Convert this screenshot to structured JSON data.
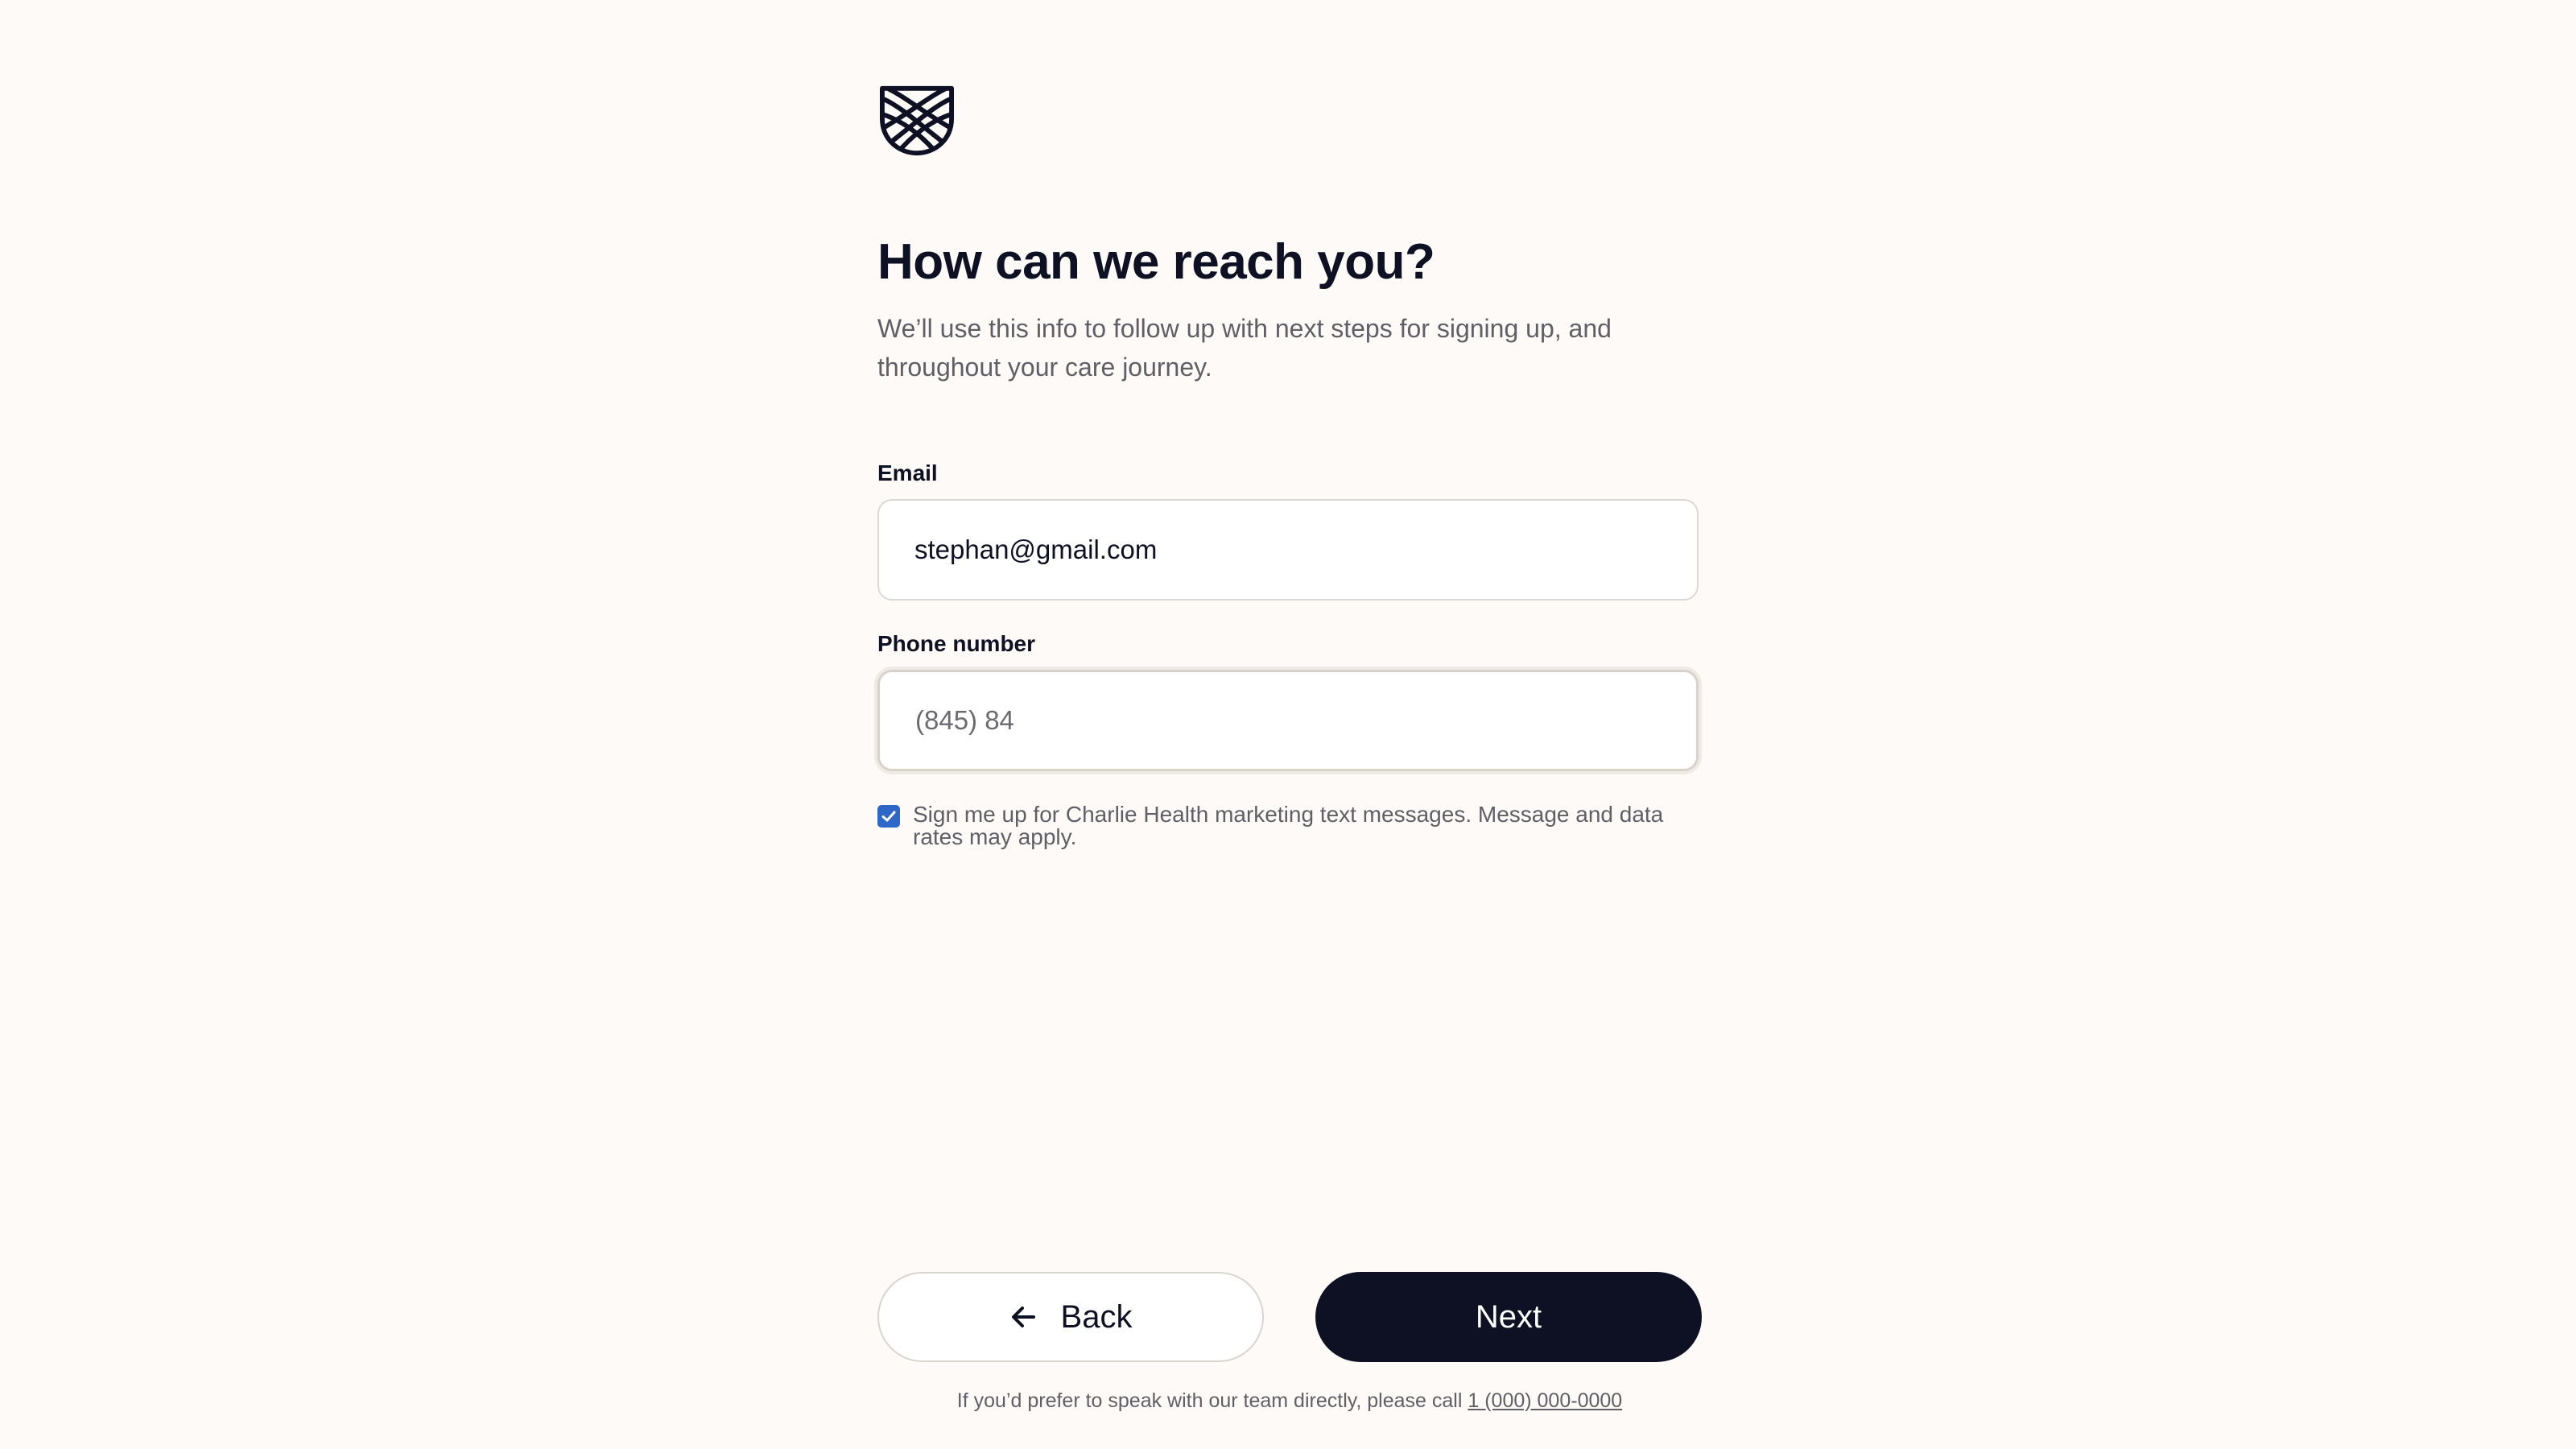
{
  "logo": {
    "icon": "shield-crosshatch-icon"
  },
  "header": {
    "title": "How can we reach you?",
    "subtitle": "We’ll use this info to follow up with next steps for signing up, and throughout your care journey."
  },
  "form": {
    "email": {
      "label": "Email",
      "value": "stephan@gmail.com"
    },
    "phone": {
      "label": "Phone number",
      "value": "(845) 84"
    },
    "marketing_opt_in": {
      "checked": true,
      "label": "Sign me up for Charlie Health marketing text messages. Message and data rates may apply."
    }
  },
  "actions": {
    "back_label": "Back",
    "next_label": "Next"
  },
  "footer": {
    "text": "If you’d prefer to speak with our team directly, please call",
    "phone_link": "1 (000) 000-0000"
  },
  "colors": {
    "background": "#fdfaf7",
    "primary": "#0e1124",
    "checkbox": "#2d67c7"
  }
}
